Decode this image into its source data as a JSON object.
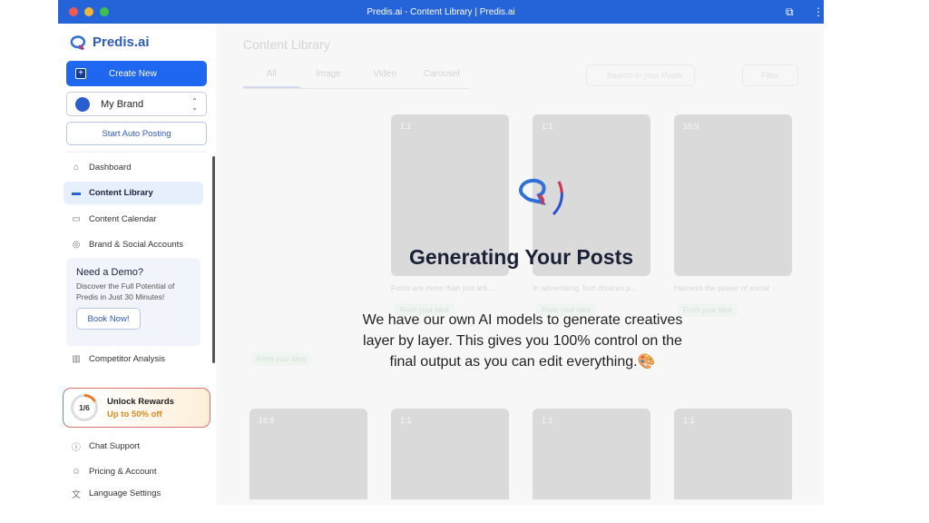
{
  "window": {
    "title": "Predis.ai - Content Library | Predis.ai"
  },
  "sidebar": {
    "logo": "Predis.ai",
    "create_new": "Create New",
    "brand": "My Brand",
    "auto_posting": "Start Auto Posting",
    "nav": [
      {
        "label": "Dashboard",
        "icon": "home-icon"
      },
      {
        "label": "Content Library",
        "icon": "library-icon",
        "active": true
      },
      {
        "label": "Content Calendar",
        "icon": "calendar-icon"
      },
      {
        "label": "Brand & Social Accounts",
        "icon": "target-icon"
      }
    ],
    "demo": {
      "title": "Need a Demo?",
      "text": "Discover the Full Potential of Predis in Just 30 Minutes!",
      "button": "Book Now!"
    },
    "competitor": "Competitor Analysis",
    "rewards": {
      "progress": "1/6",
      "title": "Unlock Rewards",
      "subtitle": "Up to 50% off"
    },
    "bottom": [
      {
        "label": "Chat Support"
      },
      {
        "label": "Pricing & Account"
      },
      {
        "label": "Language Settings"
      }
    ]
  },
  "main": {
    "title": "Content Library",
    "tabs": [
      "All",
      "Image",
      "Video",
      "Carousel"
    ],
    "search_placeholder": "Search in your Posts",
    "filter": "Filter",
    "cards": [
      {
        "ratio": "1:1",
        "caption": "Fonts are more than just lett...",
        "tag": "From your idea"
      },
      {
        "ratio": "1:1",
        "caption": "In advertising, font choices p...",
        "tag": "From your idea"
      },
      {
        "ratio": "16:9",
        "caption": "Harness the power of social ...",
        "tag": "From your idea"
      }
    ],
    "left_card_tag": "From your idea",
    "row2_ratios": [
      "16:9",
      "1:1",
      "1:1",
      "1:1"
    ]
  },
  "overlay": {
    "title": "Generating Your Posts",
    "description": "We have our own AI models to generate creatives layer by layer. This gives you 100% control on the final output as you can edit everything.🎨"
  },
  "colors": {
    "accent": "#1f66f0",
    "titlebar": "#2563d9",
    "reward": "#e0891a"
  }
}
